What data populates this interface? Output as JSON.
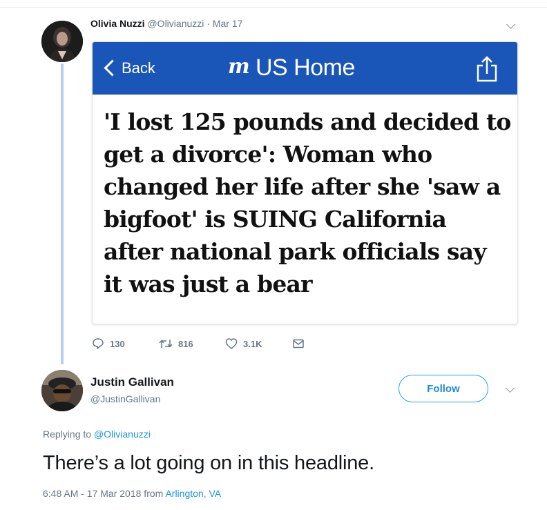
{
  "parent_tweet": {
    "author_name": "Olivia Nuzzi",
    "author_handle": "@Olivianuzzi",
    "separator": "·",
    "date": "Mar 17",
    "card": {
      "back_label": "Back",
      "brand_logo": "m",
      "brand_title": "US Home",
      "headline": "'I lost 125 pounds and decided to get a divorce': Woman who changed her life after she 'saw a bigfoot' is SUING California after national park officials say it was just a bear",
      "nav_color": "#1a55b8"
    },
    "actions": {
      "replies": "130",
      "retweets": "816",
      "likes": "3.1K"
    }
  },
  "reply_tweet": {
    "author_name": "Justin Gallivan",
    "author_handle": "@JustinGallivan",
    "follow_label": "Follow",
    "replying_prefix": "Replying to",
    "replying_handle": "@Olivianuzzi",
    "text": "There’s a lot going on in this headline.",
    "timestamp": "6:48 AM - 17 Mar 2018 from",
    "location": "Arlington, VA"
  },
  "colors": {
    "accent": "#1da1f2",
    "link": "#1b95e0",
    "muted": "#657786",
    "thread_line": "#b9cdf0"
  }
}
